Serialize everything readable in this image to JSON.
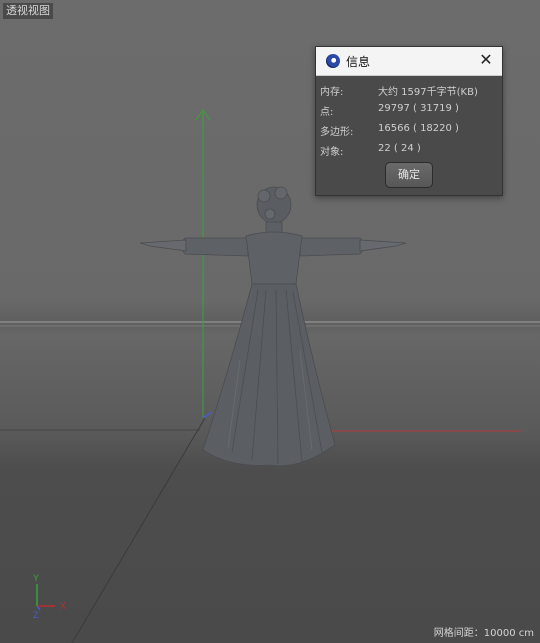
{
  "viewport": {
    "label": "透视视图",
    "grid_spacing_text": "网格间距：10000 cm",
    "axis_labels": {
      "y": "Y",
      "x": "X",
      "z": "Z"
    }
  },
  "dialog": {
    "title": "信息",
    "close_symbol": "✕",
    "rows": [
      {
        "label": "内存:",
        "value": "大约 1597千字节(KB)"
      },
      {
        "label": "点:",
        "value": "29797 ( 31719 )"
      },
      {
        "label": "多边形:",
        "value": "16566 ( 18220 )"
      },
      {
        "label": "对象:",
        "value": "22 ( 24 )"
      }
    ],
    "ok_label": "确定"
  },
  "colors": {
    "axis_y": "#3aa33a",
    "axis_x": "#b83030",
    "axis_z": "#4a5ad0",
    "model": "#5e6166"
  }
}
